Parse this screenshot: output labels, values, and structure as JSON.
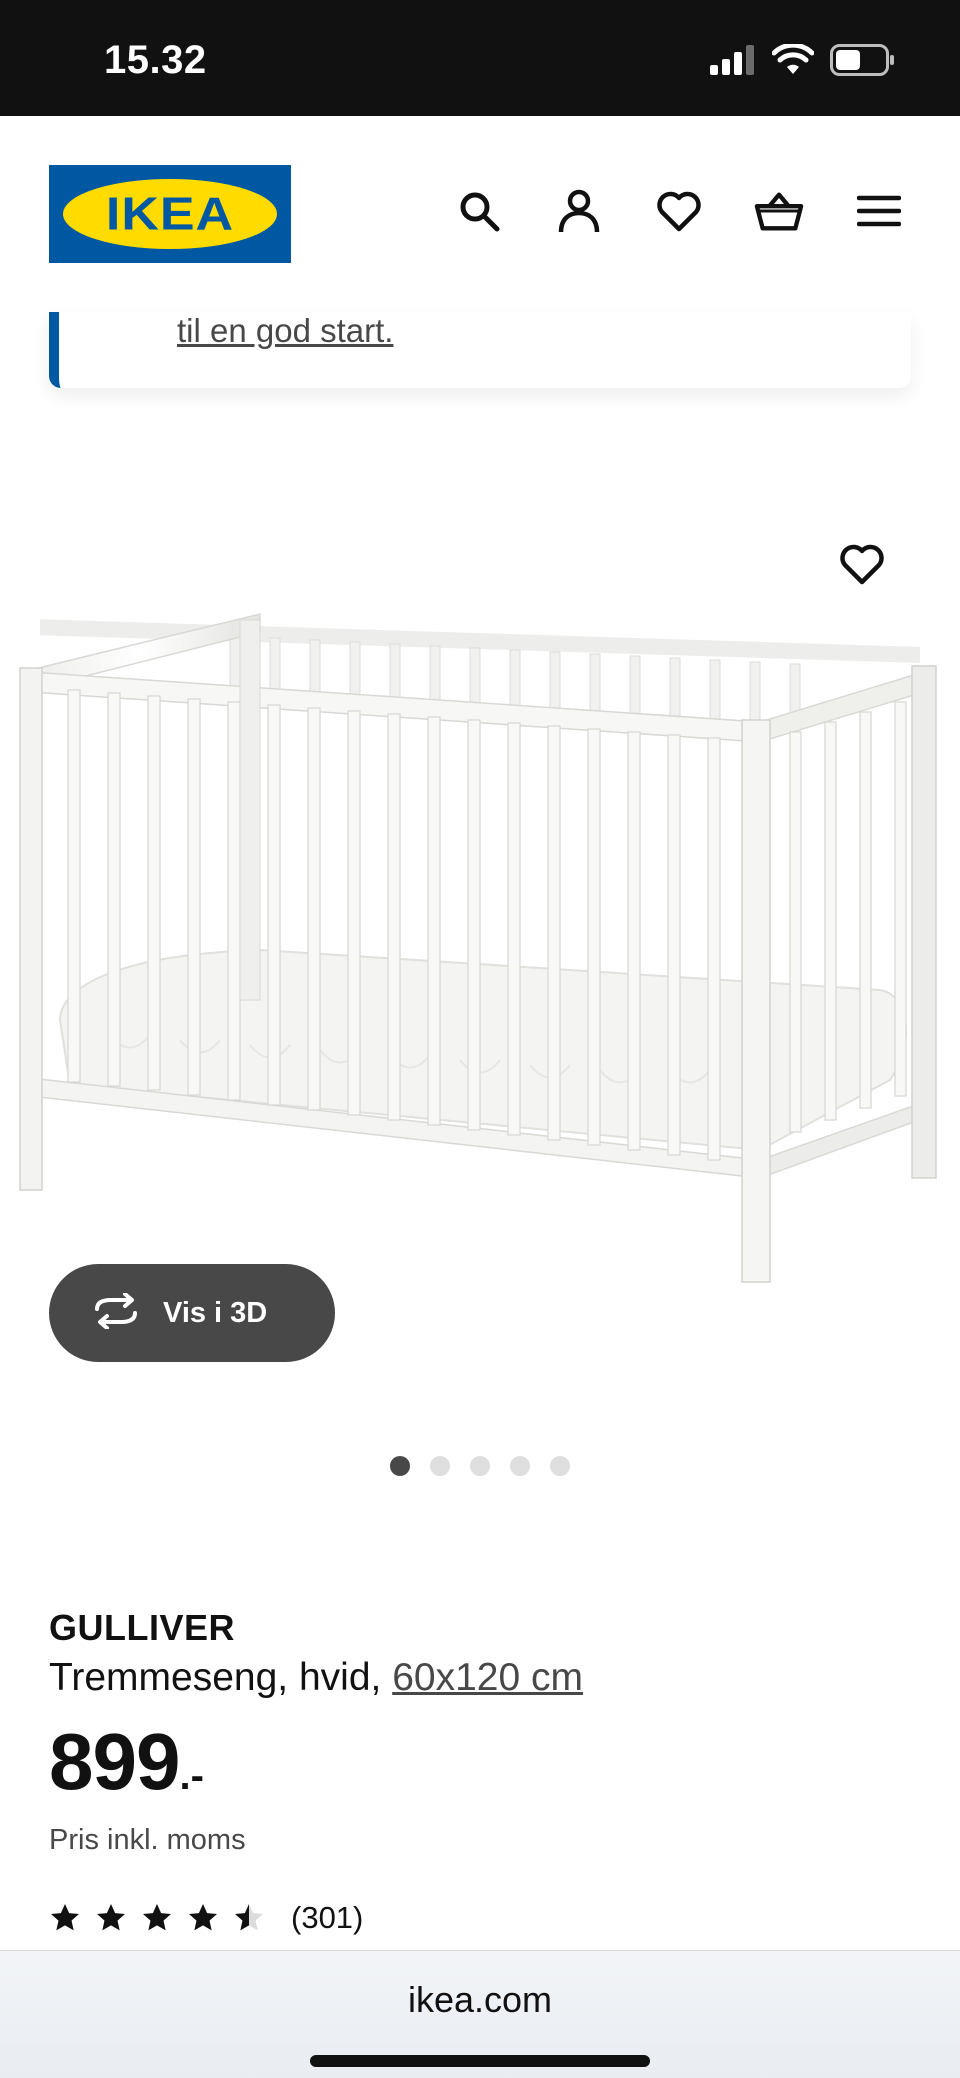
{
  "status_bar": {
    "time": "15.32",
    "icons": [
      "signal-icon",
      "wifi-icon",
      "battery-icon"
    ]
  },
  "header": {
    "logo_text": "IKEA",
    "icons": [
      "search-icon",
      "account-icon",
      "heart-icon",
      "basket-icon",
      "menu-icon"
    ],
    "brand_blue": "#0058a3",
    "brand_yellow": "#ffdb00"
  },
  "info_banner": {
    "text": "til en god start."
  },
  "product_media": {
    "view_3d_label": "Vis i 3D",
    "carousel_total": 5,
    "carousel_active": 1
  },
  "product": {
    "name": "GULLIVER",
    "description": "Tremmeseng, hvid,",
    "size_link": "60x120 cm",
    "price_integer": "899",
    "price_suffix": ".-",
    "price_note": "Pris inkl. moms",
    "rating_value": 4.5,
    "rating_count": "(301)"
  },
  "browser": {
    "url": "ikea.com"
  }
}
